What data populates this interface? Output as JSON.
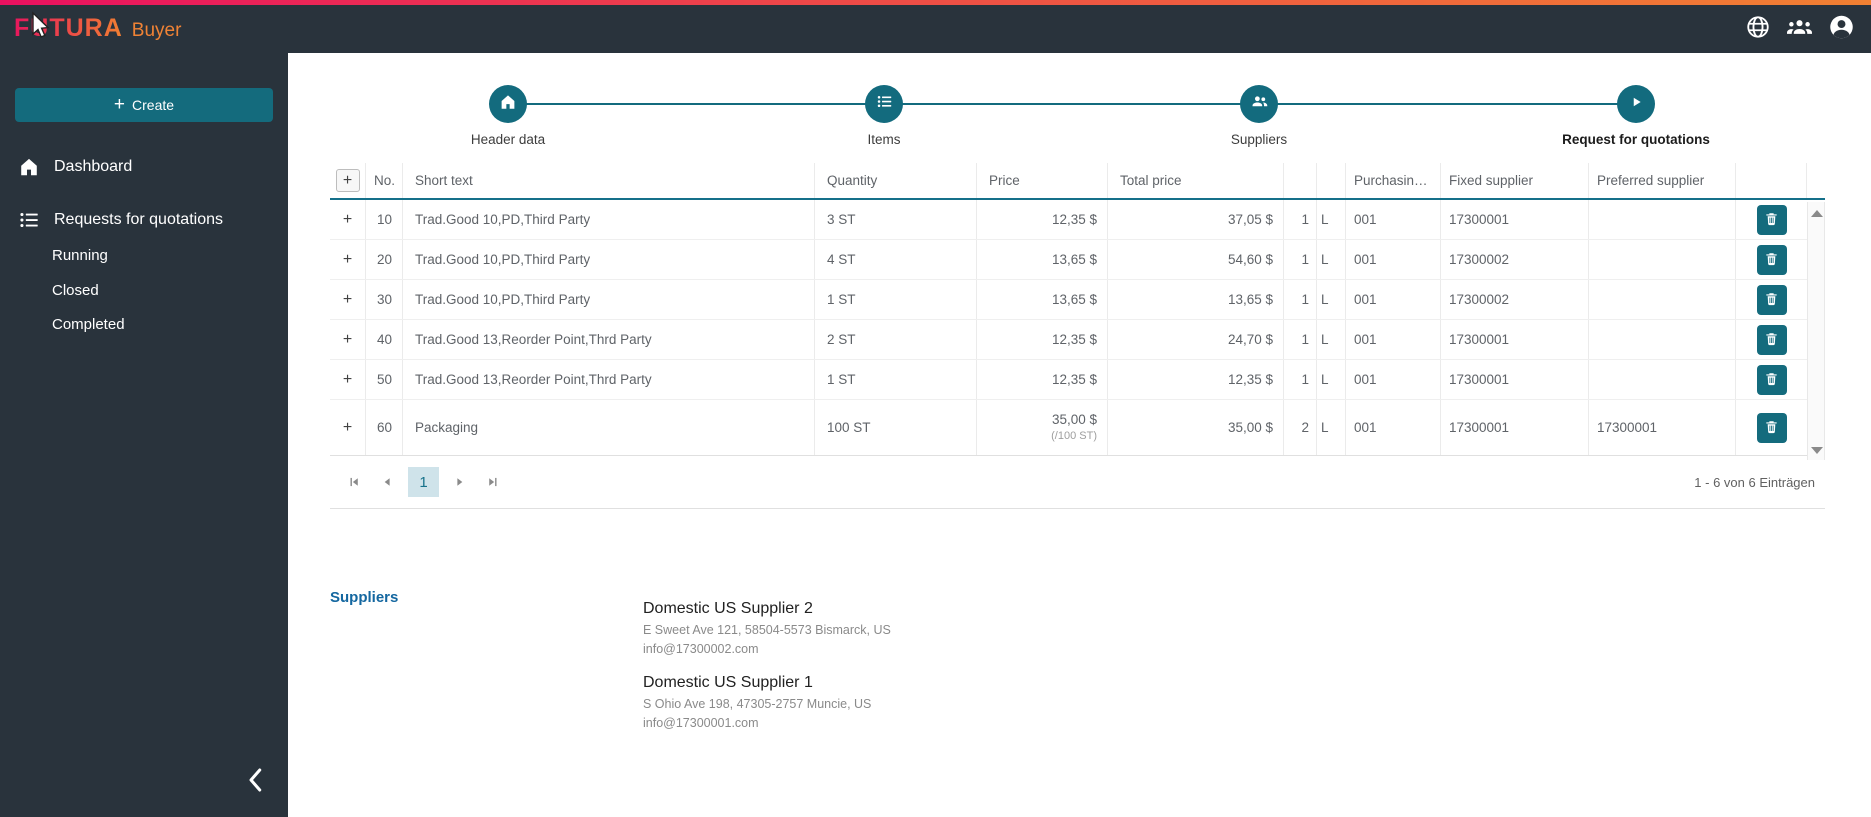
{
  "topbar": {
    "brand": "FUTURA",
    "product": "Buyer"
  },
  "sidebar": {
    "create_label": "Create",
    "create_plus": "+",
    "items": [
      {
        "label": "Dashboard"
      },
      {
        "label": "Requests for quotations"
      }
    ],
    "subitems": [
      "Running",
      "Closed",
      "Completed"
    ]
  },
  "stepper": {
    "steps": [
      {
        "label": "Header data"
      },
      {
        "label": "Items"
      },
      {
        "label": "Suppliers"
      },
      {
        "label": "Request for quotations"
      }
    ]
  },
  "table": {
    "add_glyph": "+",
    "expand_glyph": "+",
    "headers": {
      "no": "No.",
      "short": "Short text",
      "qty": "Quantity",
      "price": "Price",
      "total": "Total price",
      "purchasing": "Purchasin…",
      "fixed": "Fixed supplier",
      "preferred": "Preferred supplier"
    },
    "rows": [
      {
        "no": "10",
        "short": "Trad.Good 10,PD,Third Party",
        "qty": "3 ST",
        "price": "12,35 $",
        "price_sub": "",
        "total": "37,05 $",
        "c1": "1",
        "c2": "L",
        "purchasing": "001",
        "fixed": "17300001",
        "preferred": ""
      },
      {
        "no": "20",
        "short": "Trad.Good 10,PD,Third Party",
        "qty": "4 ST",
        "price": "13,65 $",
        "price_sub": "",
        "total": "54,60 $",
        "c1": "1",
        "c2": "L",
        "purchasing": "001",
        "fixed": "17300002",
        "preferred": ""
      },
      {
        "no": "30",
        "short": "Trad.Good 10,PD,Third Party",
        "qty": "1 ST",
        "price": "13,65 $",
        "price_sub": "",
        "total": "13,65 $",
        "c1": "1",
        "c2": "L",
        "purchasing": "001",
        "fixed": "17300002",
        "preferred": ""
      },
      {
        "no": "40",
        "short": "Trad.Good 13,Reorder Point,Thrd Party",
        "qty": "2 ST",
        "price": "12,35 $",
        "price_sub": "",
        "total": "24,70 $",
        "c1": "1",
        "c2": "L",
        "purchasing": "001",
        "fixed": "17300001",
        "preferred": ""
      },
      {
        "no": "50",
        "short": "Trad.Good 13,Reorder Point,Thrd Party",
        "qty": "1 ST",
        "price": "12,35 $",
        "price_sub": "",
        "total": "12,35 $",
        "c1": "1",
        "c2": "L",
        "purchasing": "001",
        "fixed": "17300001",
        "preferred": ""
      },
      {
        "no": "60",
        "short": "Packaging",
        "qty": "100 ST",
        "price": "35,00 $",
        "price_sub": "(/100 ST)",
        "total": "35,00 $",
        "c1": "2",
        "c2": "L",
        "purchasing": "001",
        "fixed": "17300001",
        "preferred": "17300001"
      }
    ],
    "pagination": {
      "page": "1",
      "summary": "1 - 6 von 6 Einträgen"
    }
  },
  "suppliers_section": {
    "title": "Suppliers",
    "entries": [
      {
        "name": "Domestic US Supplier 2",
        "address": "E Sweet Ave 121, 58504-5573 Bismarck, US",
        "email": "info@17300002.com"
      },
      {
        "name": "Domestic US Supplier 1",
        "address": "S Ohio Ave 198, 47305-2757 Muncie, US",
        "email": "info@17300001.com"
      }
    ]
  },
  "colors": {
    "accent_teal": "#146b7d",
    "topbar_bg": "#29333c",
    "gradient_start": "#ea1160",
    "gradient_end": "#f08032",
    "active_page_bg": "#cfe3ea",
    "header_border": "#15708a"
  }
}
